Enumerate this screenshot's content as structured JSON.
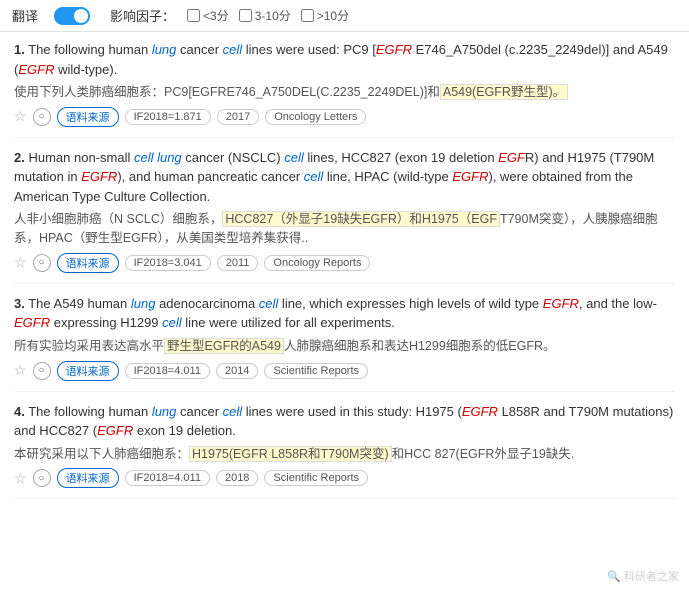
{
  "topbar": {
    "toggle_label": "翻译",
    "filter_label": "影响因子：",
    "filters": [
      {
        "id": "f1",
        "label": "<3分"
      },
      {
        "id": "f2",
        "label": "3-10分"
      },
      {
        "id": "f3",
        "label": ">10分"
      }
    ]
  },
  "results": [
    {
      "number": "1.",
      "en_parts": [
        {
          "text": "The following human ",
          "type": "normal"
        },
        {
          "text": "lung",
          "type": "italic-blue"
        },
        {
          "text": " cancer ",
          "type": "normal"
        },
        {
          "text": "cell",
          "type": "italic-blue"
        },
        {
          "text": " lines were used: PC9 [",
          "type": "normal"
        },
        {
          "text": "EGFR",
          "type": "italic-red"
        },
        {
          "text": " E746_A750del (c.2235_2249del)] and A549 (",
          "type": "normal"
        },
        {
          "text": "EGFR",
          "type": "italic-red"
        },
        {
          "text": " wild-type).",
          "type": "normal"
        }
      ],
      "cn_text": "使用下列人类肺癌细胞系：PC9[EGFRE746_A750DEL(C.2235_2249DEL)]和",
      "cn_highlight": "A549(EGFR野生型)。",
      "meta": {
        "if_value": "IF2018=1.871",
        "year": "2017",
        "journal": "Oncology Letters"
      }
    },
    {
      "number": "2.",
      "en_parts": [
        {
          "text": "Human non-small ",
          "type": "normal"
        },
        {
          "text": "cell lung",
          "type": "italic-blue"
        },
        {
          "text": " cancer (NSCLC) ",
          "type": "normal"
        },
        {
          "text": "cell",
          "type": "italic-blue"
        },
        {
          "text": " lines, HCC827 (exon 19 deletion ",
          "type": "normal"
        },
        {
          "text": "EGF",
          "type": "italic-red"
        },
        {
          "text": "R) and H1975 (T790M mutation in ",
          "type": "normal"
        },
        {
          "text": "EGFR",
          "type": "italic-red"
        },
        {
          "text": "), and human pancreatic cancer ",
          "type": "normal"
        },
        {
          "text": "cell",
          "type": "italic-blue"
        },
        {
          "text": " line, HPAC (wild-type ",
          "type": "normal"
        },
        {
          "text": "EGFR",
          "type": "italic-red"
        },
        {
          "text": "), were obtained from the American Type Culture Collection.",
          "type": "normal"
        }
      ],
      "cn_before": "人非小细胞肺癌（N SCLC）细胞系，",
      "cn_highlight1": "HCC827（外显子19缺失EGFR）和H1975（EGF",
      "cn_after1": "T790M突变），人胰腺癌细胞系，HPAC（野生型EGFR），从美国类型培养集获得..",
      "meta": {
        "if_value": "IF2018=3.041",
        "year": "2011",
        "journal": "Oncology Reports"
      }
    },
    {
      "number": "3.",
      "en_parts": [
        {
          "text": "The A549 human ",
          "type": "normal"
        },
        {
          "text": "lung",
          "type": "italic-blue"
        },
        {
          "text": " adenocarcinoma ",
          "type": "normal"
        },
        {
          "text": "cell",
          "type": "italic-blue"
        },
        {
          "text": " line, which expresses high levels of wild type ",
          "type": "normal"
        },
        {
          "text": "EGFR",
          "type": "italic-red"
        },
        {
          "text": ", and the low-",
          "type": "normal"
        },
        {
          "text": "EGFR",
          "type": "italic-red"
        },
        {
          "text": " expressing H1299 ",
          "type": "normal"
        },
        {
          "text": "cell",
          "type": "italic-blue"
        },
        {
          "text": " line were utilized for all experiments.",
          "type": "normal"
        }
      ],
      "cn_before": "所有实验均采用表达高水平",
      "cn_highlight": "野生型EGFR的A549",
      "cn_after": "人肺腺癌细胞系和表达H1299细胞系的低EGFR。",
      "meta": {
        "if_value": "IF2018=4.011",
        "year": "2014",
        "journal": "Scientific Reports"
      }
    },
    {
      "number": "4.",
      "en_parts": [
        {
          "text": "The following human ",
          "type": "normal"
        },
        {
          "text": "lung",
          "type": "italic-blue"
        },
        {
          "text": " cancer ",
          "type": "normal"
        },
        {
          "text": "cell",
          "type": "italic-blue"
        },
        {
          "text": " lines were used in this study: H1975 (",
          "type": "normal"
        },
        {
          "text": "EGFR",
          "type": "italic-red"
        },
        {
          "text": " L858R and T790M mutations) and HCC827 (",
          "type": "normal"
        },
        {
          "text": "EGFR",
          "type": "italic-red"
        },
        {
          "text": " exon 19 deletion.",
          "type": "normal"
        }
      ],
      "cn_before": "本研究采用以下人肺癌细胞系：",
      "cn_highlight": "H1975(EGFR L858R和T790M突变)",
      "cn_after": "和HCC 827(EGFR外显子19缺失.",
      "meta": {
        "if_value": "IF2018=4.011",
        "year": "2018",
        "journal": "Scientific Reports"
      }
    }
  ],
  "labels": {
    "source": "语料来源",
    "watermark": "科研者之家"
  }
}
